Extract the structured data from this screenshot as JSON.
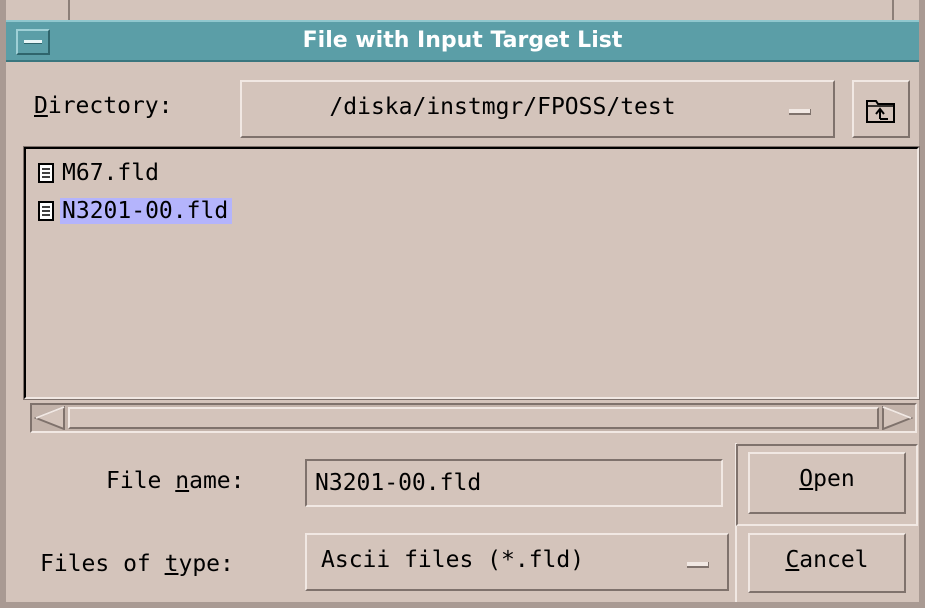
{
  "window": {
    "title": "File with Input Target List"
  },
  "directory": {
    "label_mnemonic": "D",
    "label_rest": "irectory:",
    "value": "/diska/instmgr/FPOSS/test",
    "up_button_icon": "folder-up-icon"
  },
  "files": [
    {
      "name": "M67.fld",
      "icon": "document-icon",
      "selected": false
    },
    {
      "name": "N3201-00.fld",
      "icon": "document-icon",
      "selected": true
    }
  ],
  "file_name": {
    "label_before": "File ",
    "label_mnemonic": "n",
    "label_after": "ame:",
    "value": "N3201-00.fld"
  },
  "file_type": {
    "label_before": "Files of ",
    "label_mnemonic": "t",
    "label_after": "ype:",
    "value": "Ascii files (*.fld)"
  },
  "buttons": {
    "open_mnemonic": "O",
    "open_rest": "pen",
    "cancel_mnemonic": "C",
    "cancel_rest": "ancel"
  },
  "colors": {
    "title_bar": "#5b9ea7",
    "background": "#d4c4bb",
    "selection": "#b4b4fc"
  }
}
